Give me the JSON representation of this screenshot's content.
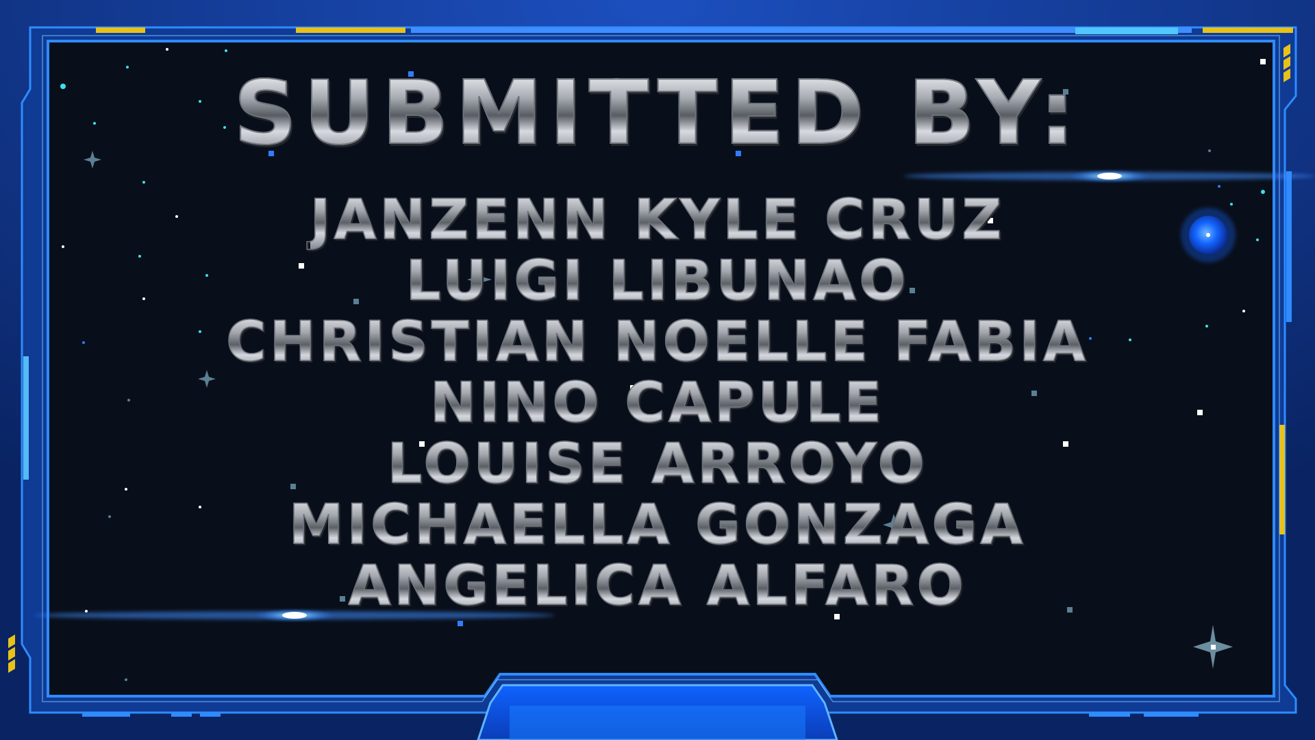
{
  "slide": {
    "title": "SUBMITTED BY:",
    "names": [
      "JANZENN KYLE CRUZ",
      "LUIGI LIBUNAO",
      "CHRISTIAN NOELLE FABIA",
      "NINO CAPULE",
      "LOUISE ARROYO",
      "MICHAELLA GONZAGA",
      "ANGELICA ALFARO"
    ]
  },
  "colors": {
    "panel": "#090f1a",
    "frame_outer": "#0b2a6b",
    "frame_glow": "#2f8cff",
    "accent_yellow": "#e8c21a",
    "star_cyan": "#3fe0ea",
    "orb": "#1466ff"
  },
  "icons": [
    "sparkle-icon",
    "glow-orb-icon",
    "lens-flare"
  ]
}
